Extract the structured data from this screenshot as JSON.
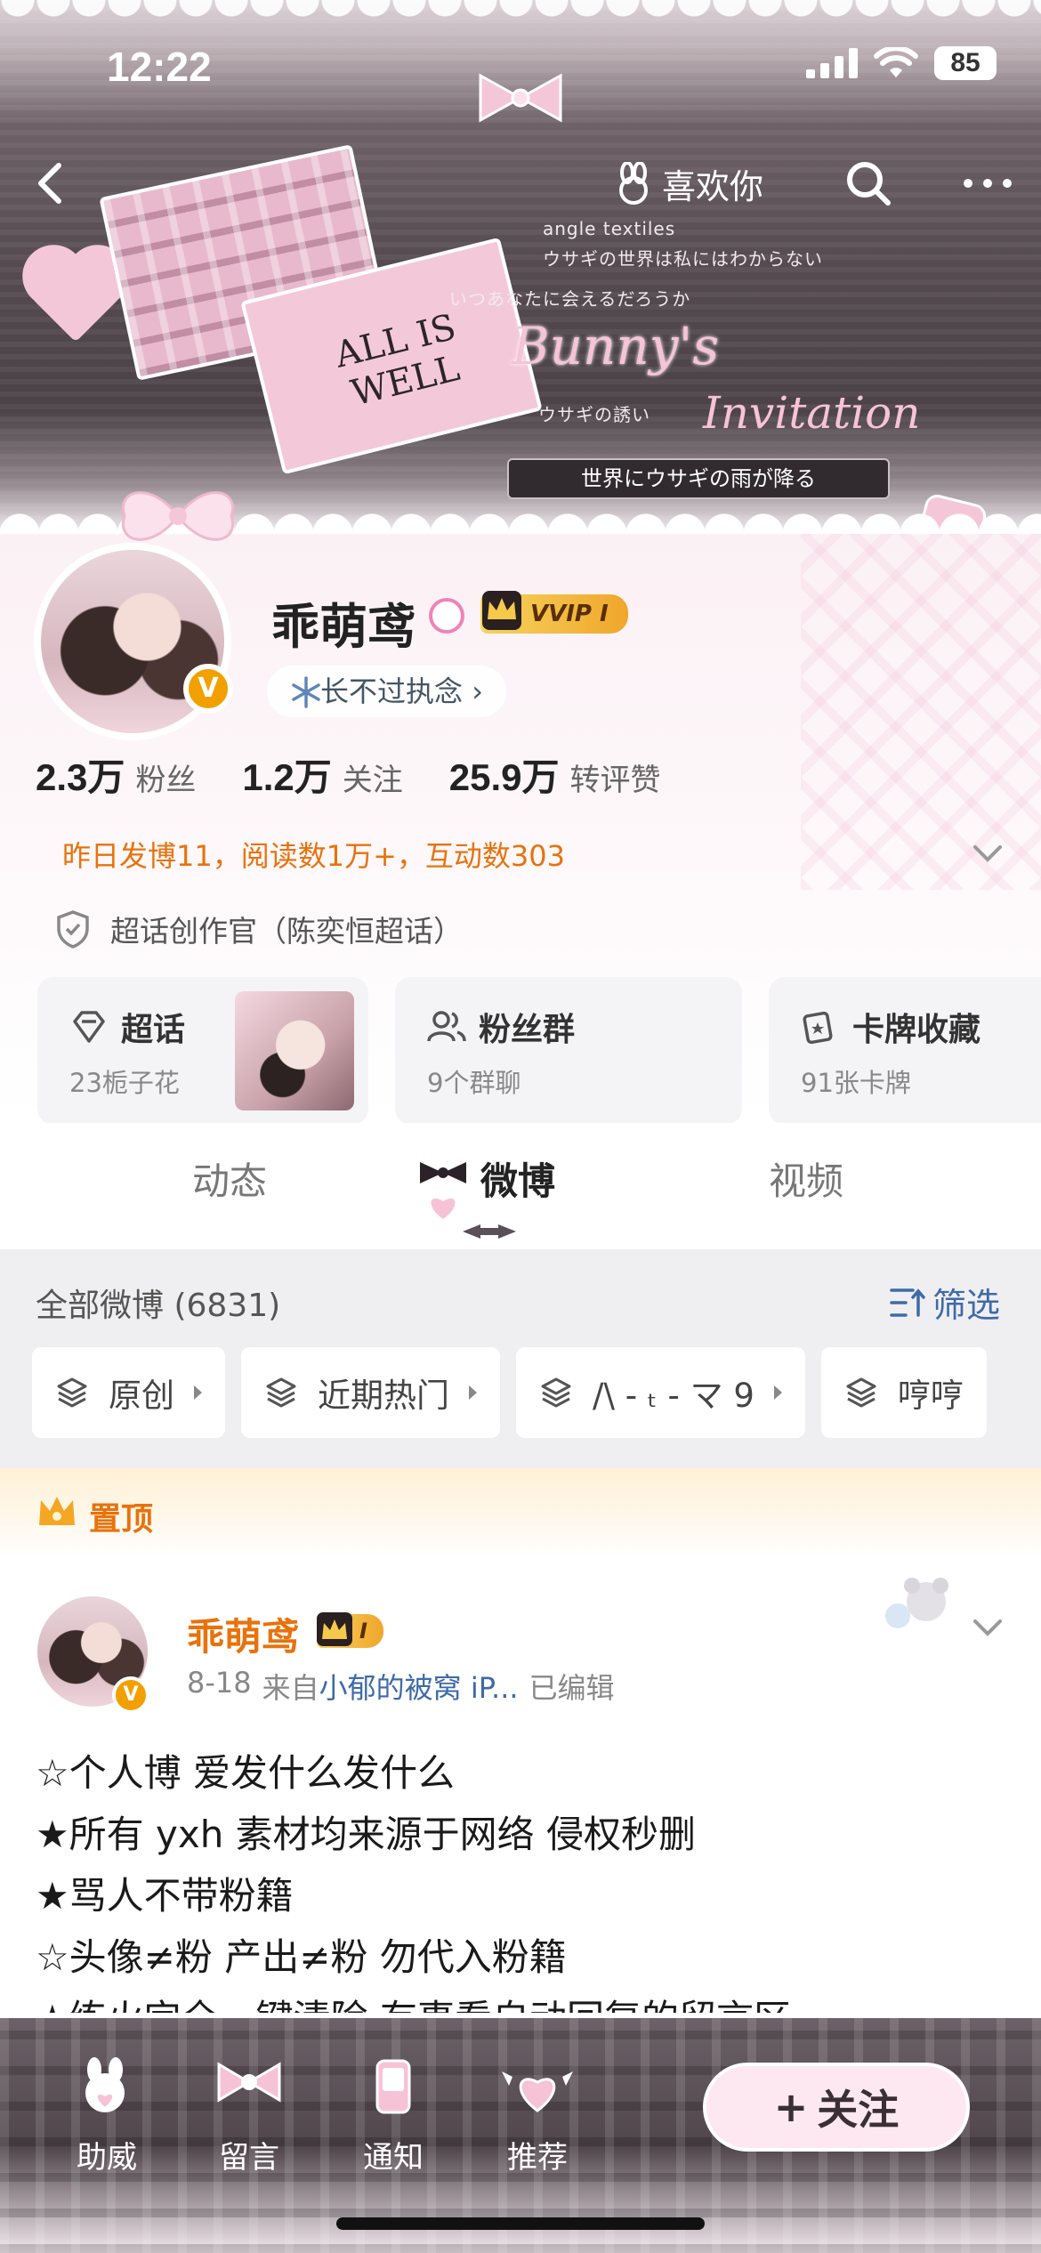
{
  "status_bar": {
    "time": "12:22",
    "battery": "85"
  },
  "banner": {
    "like_label": "喜欢你",
    "jp_line1": "ウサギの世界は私にはわからない",
    "jp_line2": "いつあなたに会えるだろうか",
    "jp_line3": "ウサギの誘い",
    "card_text": "ALL IS WELL",
    "script_title": "Bunny's",
    "script_sub": "Invitation",
    "strip_text": "世界にウサギの雨が降る",
    "small_label": "angle textiles"
  },
  "profile": {
    "username": "乖萌鸢",
    "vip_label": "VVIP I",
    "verified_mark": "V",
    "tag": "长不过执念",
    "stats": [
      {
        "num": "2.3万",
        "label": "粉丝"
      },
      {
        "num": "1.2万",
        "label": "关注"
      },
      {
        "num": "25.9万",
        "label": "转评赞"
      }
    ],
    "daily": "昨日发博11，阅读数1万+，互动数303",
    "super_topic_title": "超话创作官（陈奕恒超话）"
  },
  "cards": [
    {
      "title": "超话",
      "sub": "23栀子花"
    },
    {
      "title": "粉丝群",
      "sub": "9个群聊"
    },
    {
      "title": "卡牌收藏",
      "sub": "91张卡牌"
    }
  ],
  "tabs": [
    {
      "label": "动态"
    },
    {
      "label": "微博"
    },
    {
      "label": "视频"
    }
  ],
  "feed": {
    "count_label": "全部微博 (6831)",
    "filter_label": "筛选",
    "chips": [
      "原创",
      "近期热门",
      "/\\ - ₜ - マ 9",
      "哼哼"
    ]
  },
  "pinned": {
    "label": "置顶",
    "author": "乖萌鸢",
    "badge": "I",
    "date": "8-18",
    "from_prefix": "来自",
    "source": "小郁的被窝 iP...",
    "edited": "已编辑",
    "lines": [
      "☆个人博 爱发什么发什么",
      "★所有 yxh 素材均来源于网络 侵权秒删",
      "★骂人不带粉籍",
      "☆头像≠粉 产出≠粉  勿代入粉籍",
      "★练火完全一键清除 有事看自动回复的留言区"
    ]
  },
  "bottom_bar": {
    "items": [
      "助威",
      "留言",
      "通知",
      "推荐"
    ],
    "follow_label": "关注",
    "follow_plus": "+"
  },
  "colors": {
    "accent_orange": "#e8720c",
    "link_blue": "#3e6aa8",
    "badge_gold": "#f2a000",
    "pink": "#f4c7d8"
  }
}
